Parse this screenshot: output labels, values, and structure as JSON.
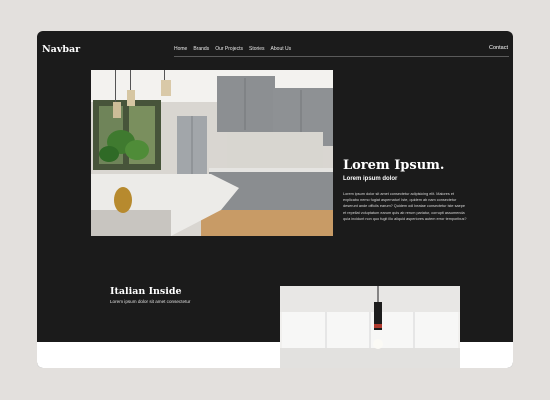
{
  "navbar": {
    "brand": "Navbar",
    "links": [
      "Home",
      "Brands",
      "Our Projects",
      "Stories",
      "About Us"
    ],
    "contact": "Contact"
  },
  "hero": {
    "title": "Lorem Ipsum.",
    "subtitle": "Lorem ipsum dolor",
    "body": "Lorem ipsum dolor sit amet consectetur adipisicing elit. Maiores et explicabo nemo fugiat aspernatur! Iste, quidem ab nam consectetur deserunt ande officiis earum? Quidem odi beatae consectetur iste saepe et repellat voluptatum earum quis ab rerum pariatur, corrupti assumenda quia incidunt non quo fugit illo aliquid asperiores autem error temporibus?"
  },
  "feature": {
    "title": "Italian Inside",
    "subtitle": "Lorem ipsum dolor sit amet consectetur"
  }
}
